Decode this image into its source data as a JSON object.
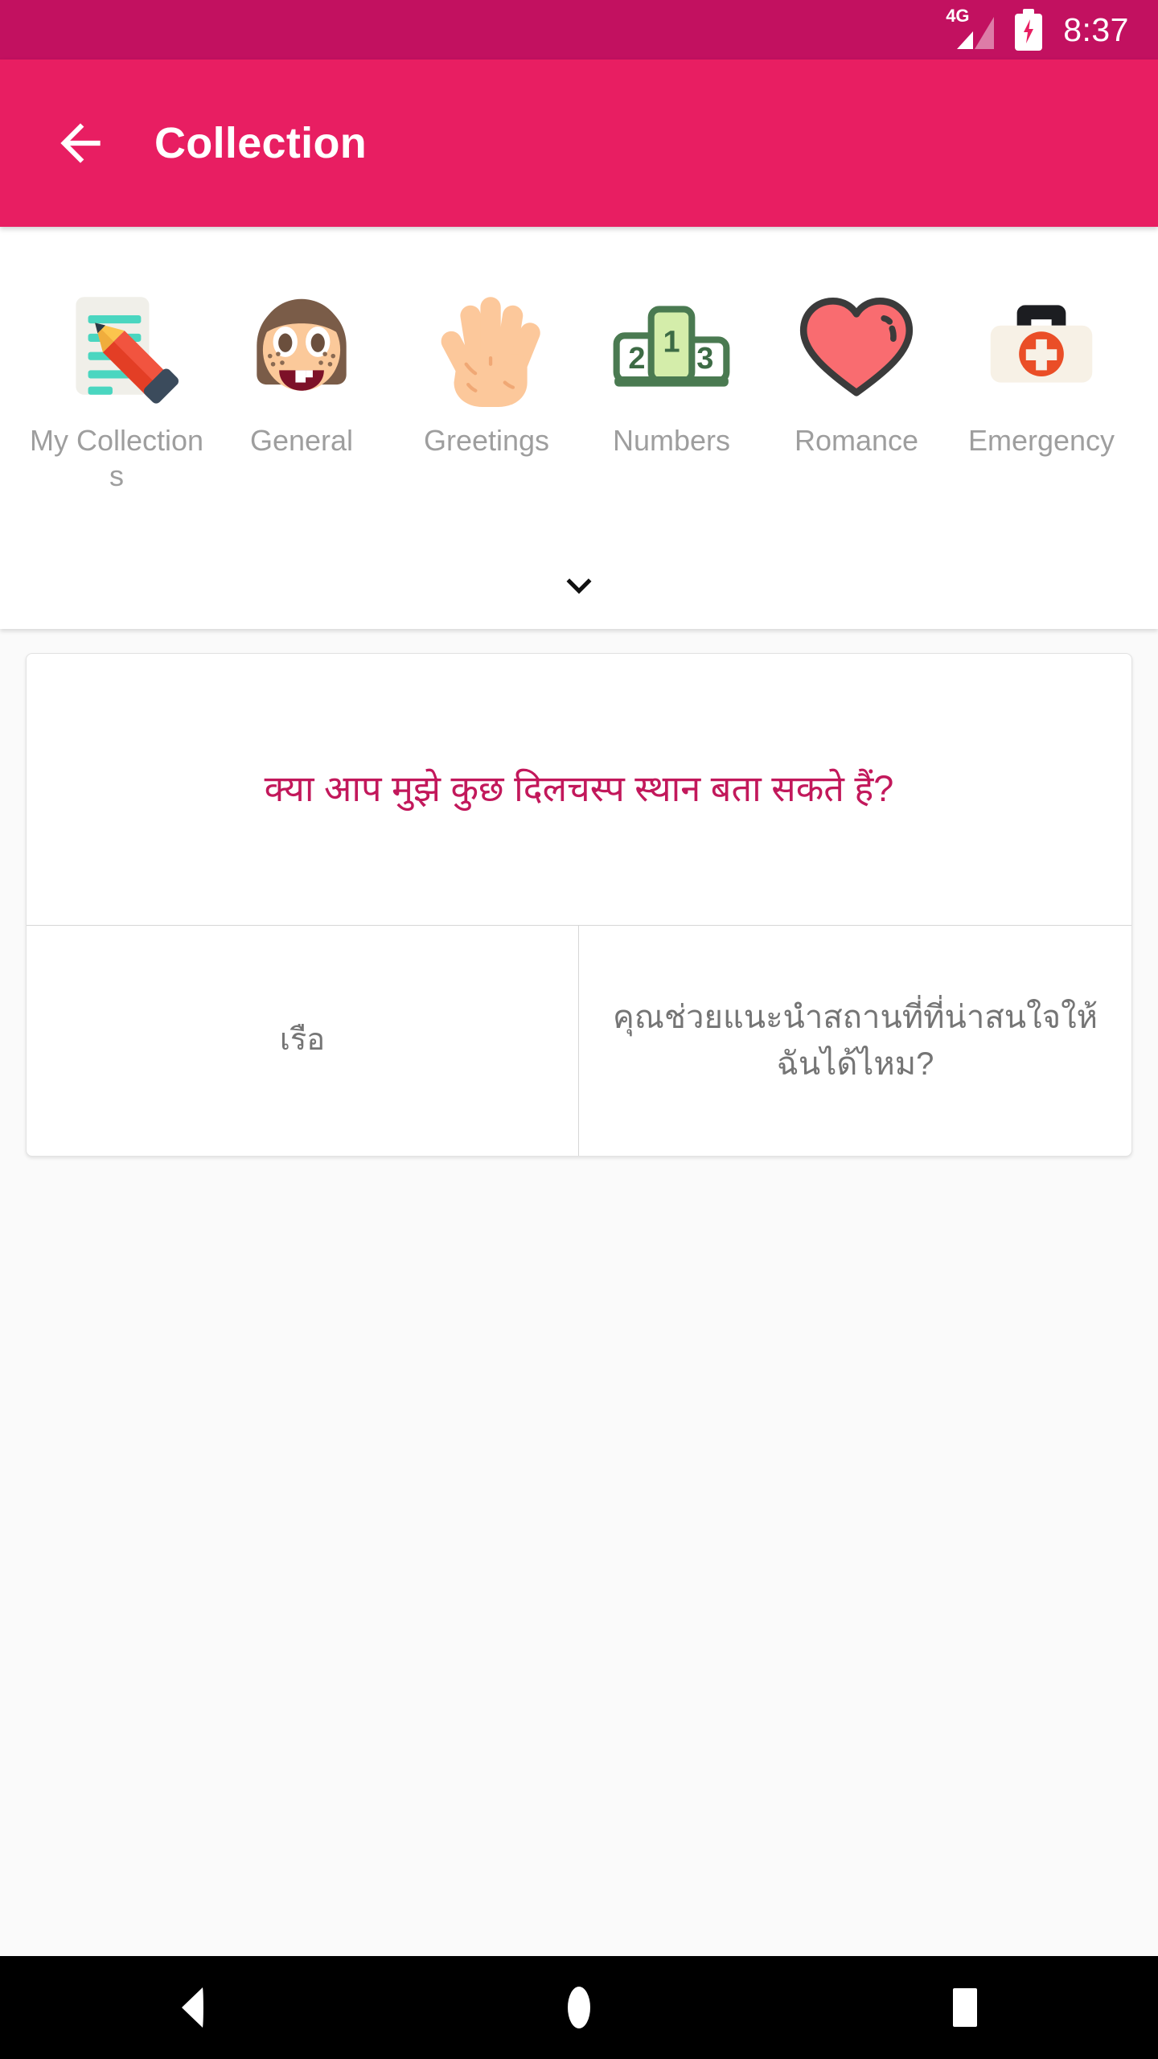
{
  "statusbar": {
    "network_label": "4G",
    "time": "8:37",
    "signal_icon": "signal-bars-icon",
    "battery_icon": "battery-charging-icon",
    "background_color": "#c21160"
  },
  "appbar": {
    "title": "Collection",
    "back_icon": "back-arrow-icon",
    "background_color": "#e81e62",
    "title_color": "#ffffff"
  },
  "categories": {
    "expand_icon": "chevron-down-icon",
    "label_color": "#9e9e9e",
    "items": [
      {
        "label": "My Collections",
        "icon": "memo-pencil-icon"
      },
      {
        "label": "General",
        "icon": "girl-face-icon"
      },
      {
        "label": "Greetings",
        "icon": "open-hand-icon"
      },
      {
        "label": "Numbers",
        "icon": "podium-123-icon"
      },
      {
        "label": "Romance",
        "icon": "heart-icon"
      },
      {
        "label": "Emergency",
        "icon": "first-aid-kit-icon"
      }
    ]
  },
  "card": {
    "headline": "क्या आप मुझे कुछ दिलचस्प स्थान बता सकते हैं?",
    "headline_color": "#c2185b",
    "left_cell": "เรือ",
    "right_cell": "คุณช่วยแนะนำสถานที่ที่น่าสนใจให้ฉันได้ไหม?",
    "cell_text_color": "#757575"
  },
  "navbar": {
    "back_icon": "nav-back-triangle-icon",
    "home_icon": "nav-home-circle-icon",
    "recents_icon": "nav-recents-square-icon",
    "background_color": "#000000"
  }
}
